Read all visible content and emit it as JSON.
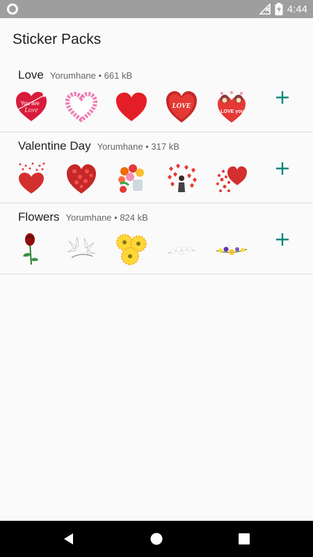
{
  "status_bar": {
    "time": "4:44",
    "icons": [
      "circle-icon",
      "no-signal-icon",
      "battery-charging-icon"
    ]
  },
  "app_bar": {
    "title": "Sticker Packs"
  },
  "packs": [
    {
      "name": "Love",
      "publisher": "Yorumhane",
      "size": "661 kB",
      "stickers": [
        "you-are-love-heart-sticker",
        "flower-heart-frame-sticker",
        "red-heart-sticker",
        "love-heart-sticker",
        "love-you-birds-heart-sticker"
      ],
      "sticker_text": {
        "you_are": "You are",
        "love_script": "Love",
        "love": "LOVE",
        "love_you": "LOVE you"
      }
    },
    {
      "name": "Valentine Day",
      "publisher": "Yorumhane",
      "size": "317 kB",
      "stickers": [
        "hearts-shower-sticker",
        "glitter-heart-sticker",
        "rose-bouquet-sticker",
        "hearts-with-person-sticker",
        "scattered-hearts-sticker"
      ]
    },
    {
      "name": "Flowers",
      "publisher": "Yorumhane",
      "size": "824 kB",
      "stickers": [
        "red-rose-sticker",
        "white-lily-sticker",
        "yellow-gerbera-sticker",
        "white-flower-branch-sticker",
        "wildflower-garland-sticker"
      ]
    }
  ],
  "add_icon": "plus-icon",
  "colors": {
    "status_bar": "#9e9e9e",
    "accent": "#00897b",
    "heart_red": "#e41e26",
    "divider": "#dcdcdc",
    "nav_bar": "#000000"
  },
  "nav_bar": {
    "icons": [
      "back-icon",
      "home-icon",
      "recents-icon"
    ]
  }
}
